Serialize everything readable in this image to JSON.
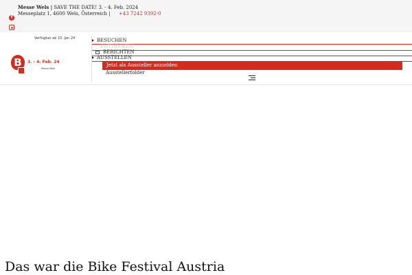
{
  "topbar": {
    "org": "Messe Wels",
    "separator": "|",
    "announcement": "SAVE THE DATE! 3. - 4. Feb. 2024",
    "address": "Messeplatz 1, 4600 Wels, Österreich |",
    "phone": "+43 7242 9392-0",
    "social": [
      {
        "icon": "facebook-icon"
      },
      {
        "icon": "instagram-icon"
      }
    ]
  },
  "logo": {
    "availability": "Verfügbar ab 10. Jan 24",
    "letter": "B",
    "date": "3. - 4. Feb. 24",
    "subtitle": "Messe Wels"
  },
  "nav": {
    "items": [
      "BESUCHEN",
      "ENTDECKEN",
      "BERICHTEN",
      "AUSSTELLEN"
    ],
    "submenu": [
      "Jetzt als Aussteller anmelden",
      "Ausstellerfolder"
    ],
    "menu_icon": "hamburger-icon"
  },
  "main": {
    "headline": "Das war die Bike Festival Austria"
  },
  "colors": {
    "accent": "#d52b1e",
    "topbar_bg": "#f5f5f5"
  }
}
